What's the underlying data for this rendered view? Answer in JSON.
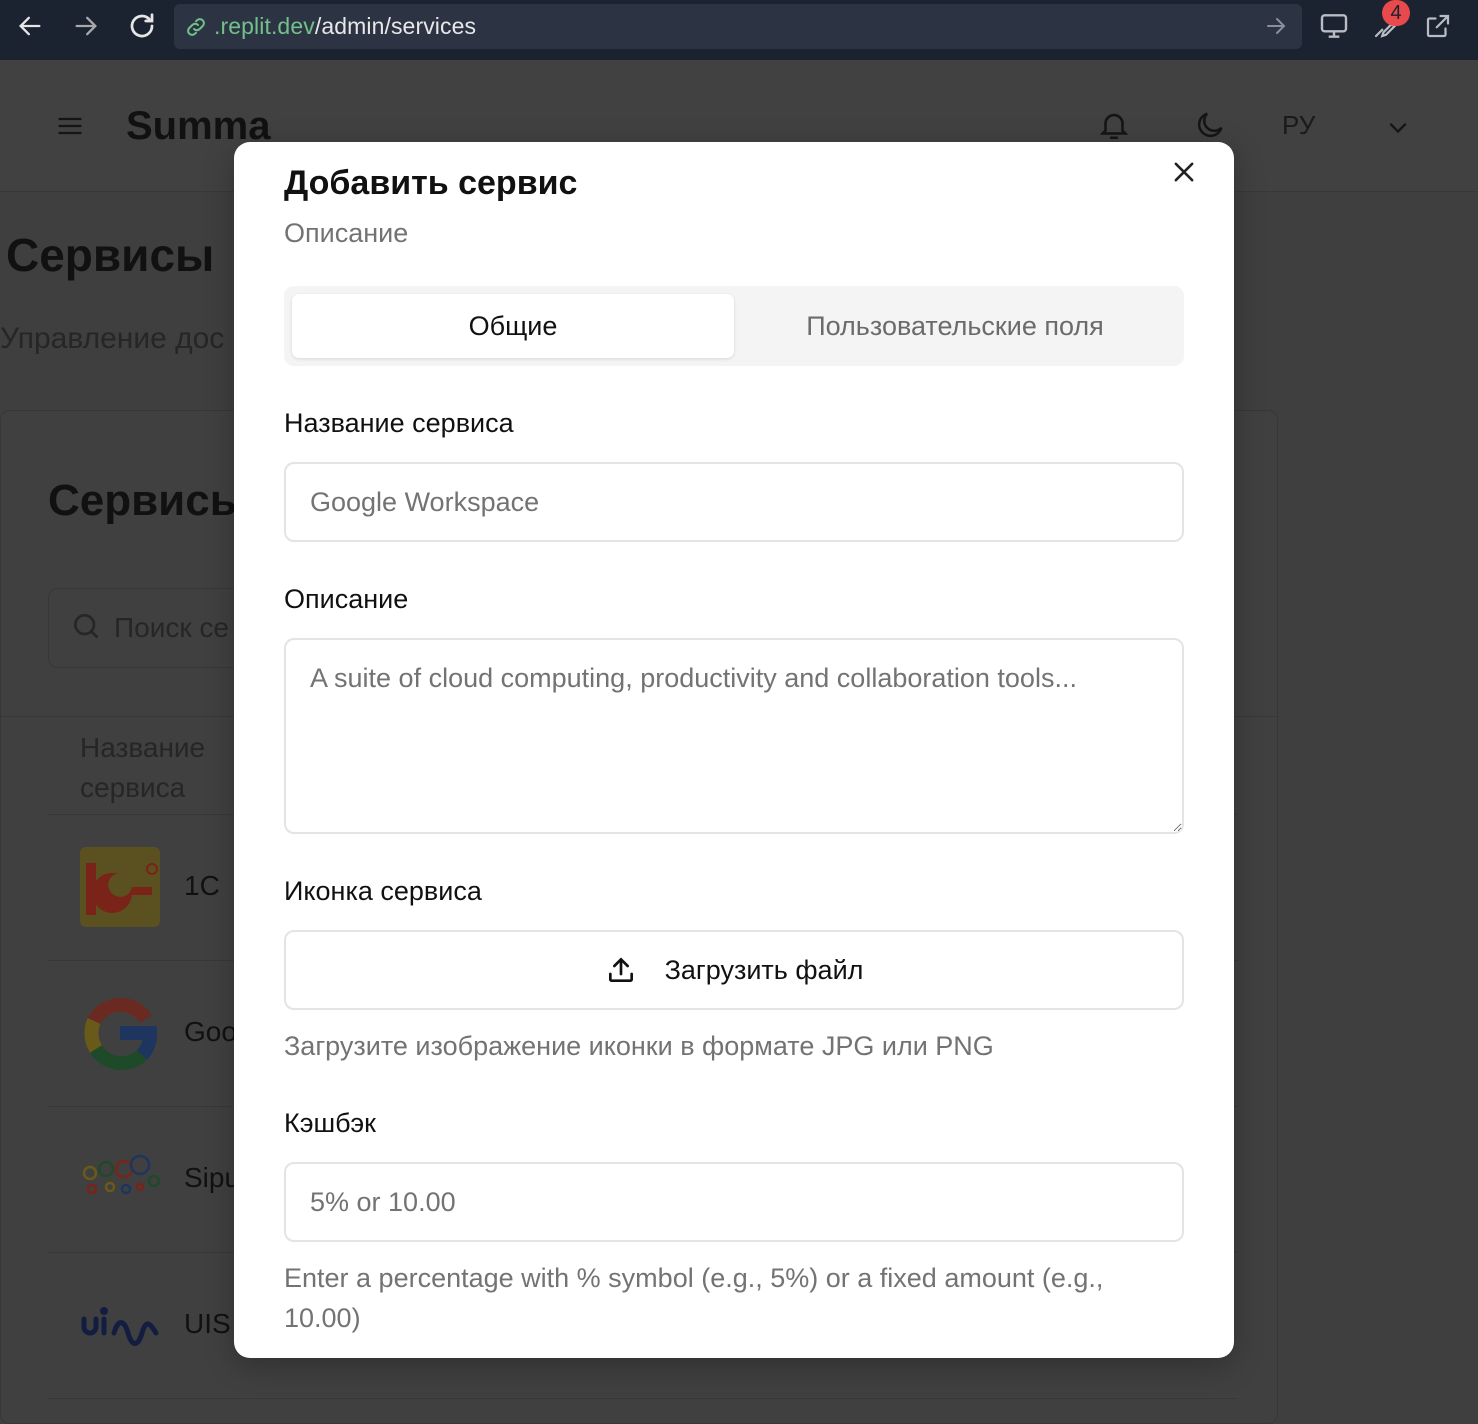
{
  "browser": {
    "url_domain": ".replit.dev",
    "url_path": "/admin/services",
    "badge_count": "4"
  },
  "header": {
    "brand": "Summa",
    "language": "РУ"
  },
  "page": {
    "title": "Сервисы",
    "subtitle": "Управление дос",
    "card_title": "Сервисы",
    "search_placeholder": "Поиск се",
    "column_header": "Название сервиса",
    "rows": [
      {
        "name": "1C",
        "logo": "1c-logo"
      },
      {
        "name": "Goo",
        "logo": "google-logo"
      },
      {
        "name": "Sipu",
        "logo": "sipuni-logo"
      },
      {
        "name": "UIS",
        "logo": "uis-logo"
      }
    ]
  },
  "modal": {
    "title": "Добавить сервис",
    "description": "Описание",
    "tabs": [
      {
        "label": "Общие",
        "active": true
      },
      {
        "label": "Пользовательские поля",
        "active": false
      }
    ],
    "fields": {
      "name_label": "Название сервиса",
      "name_placeholder": "Google Workspace",
      "description_label": "Описание",
      "description_placeholder": "A suite of cloud computing, productivity and collaboration tools...",
      "icon_label": "Иконка сервиса",
      "upload_label": "Загрузить файл",
      "icon_hint": "Загрузите изображение иконки в формате JPG или PNG",
      "cashback_label": "Кэшбэк",
      "cashback_placeholder": "5% or 10.00",
      "cashback_hint": "Enter a percentage with % symbol (e.g., 5%) or a fixed amount (e.g., 10.00)"
    }
  },
  "colors": {
    "browser_bg": "#1b2230",
    "url_domain": "#73c08a",
    "overlay_bg": "#3f3f3f",
    "badge": "#e8494a",
    "muted_text": "#737373",
    "border": "#e4e4e7"
  }
}
